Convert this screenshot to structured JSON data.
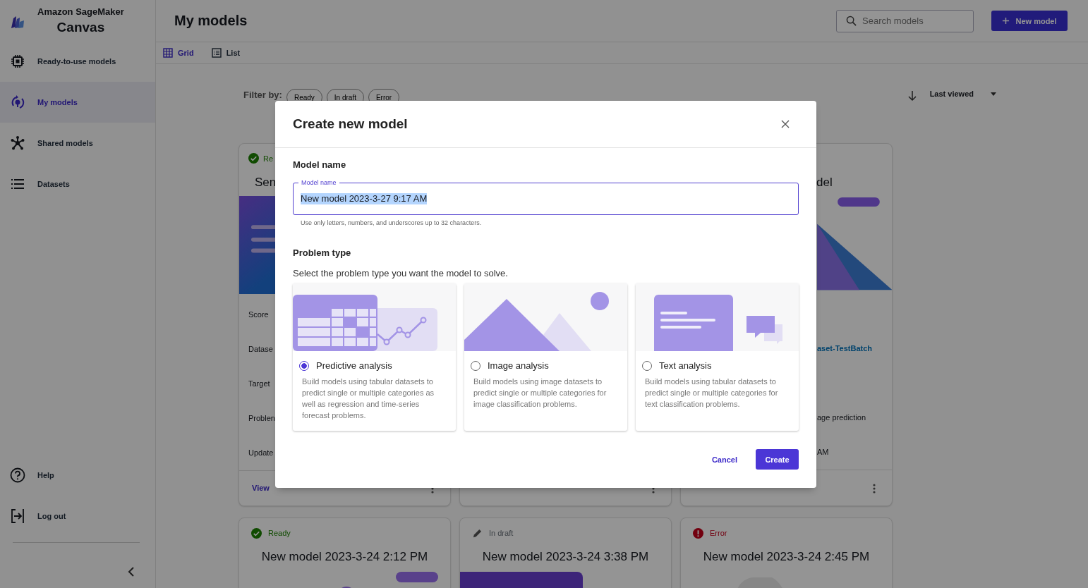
{
  "sidebar": {
    "product": "Amazon SageMaker",
    "app": "Canvas",
    "items": [
      {
        "kind": "chip",
        "label": "Ready-to-use models",
        "selected": false
      },
      {
        "kind": "models",
        "label": "My models",
        "selected": true
      },
      {
        "kind": "shared",
        "label": "Shared models",
        "selected": false
      },
      {
        "kind": "datasets",
        "label": "Datasets",
        "selected": false
      }
    ],
    "bottom_items": [
      {
        "kind": "help",
        "label": "Help"
      },
      {
        "kind": "logout",
        "label": "Log out"
      }
    ]
  },
  "header": {
    "title": "My models",
    "search": {
      "placeholder": "Search models"
    },
    "new_button": "New model"
  },
  "views": [
    {
      "kind": "grid",
      "label": "Grid",
      "selected": true
    },
    {
      "kind": "list",
      "label": "List",
      "selected": false
    }
  ],
  "filter": {
    "label": "Filter by:",
    "chips": [
      "Ready",
      "In draft",
      "Error"
    ]
  },
  "sort": {
    "label": "Last viewed"
  },
  "cards": [
    {
      "kind": "left_part",
      "status": {
        "kind": "ready",
        "label": "Re"
      },
      "title": "Sen",
      "rows": [
        {
          "kind": "label",
          "text": "Score"
        },
        {
          "kind": "label",
          "text": "Datase"
        },
        {
          "kind": "label",
          "text": "Target"
        },
        {
          "kind": "label",
          "text": "Problen"
        },
        {
          "kind": "label",
          "text": "Update"
        }
      ],
      "link": "View"
    },
    {
      "kind": "covered"
    },
    {
      "kind": "right_part",
      "title": "del",
      "rows": [
        {
          "kind": "link",
          "text": "aset-TestBatch"
        },
        {
          "kind": "value",
          "text": "age prediction"
        },
        {
          "kind": "value",
          "text": "AM"
        }
      ]
    },
    {
      "kind": "full",
      "status": {
        "kind": "ready",
        "label": "Ready"
      },
      "title": "New model 2023-3-24 2:12 PM"
    },
    {
      "kind": "full",
      "status": {
        "kind": "draft",
        "label": "In draft"
      },
      "title": "New model 2023-3-24 3:38 PM"
    },
    {
      "kind": "full",
      "status": {
        "kind": "error",
        "label": "Error"
      },
      "title": "New model 2023-3-24 2:45 PM"
    }
  ],
  "dialog": {
    "title": "Create new model",
    "name_heading": "Model name",
    "field": {
      "label": "Model name",
      "value": "New model 2023-3-27 9:17 AM",
      "hint": "Use only letters, numbers, and underscores up to 32 characters."
    },
    "problem_heading": "Problem type",
    "problem_prompt": "Select the problem type you want the model to solve.",
    "options": [
      {
        "kind": "predictive",
        "title": "Predictive analysis",
        "description": "Build models using tabular datasets to predict single or multiple categories as well as regression and time-series forecast problems.",
        "selected": true
      },
      {
        "kind": "image",
        "title": "Image analysis",
        "description": "Build models using image datasets to predict single or multiple categories for image classification problems.",
        "selected": false
      },
      {
        "kind": "text",
        "title": "Text analysis",
        "description": "Build models using tabular datasets to predict single or multiple categories for text classification problems.",
        "selected": false
      }
    ],
    "buttons": [
      {
        "kind": "secondary",
        "label": "Cancel"
      },
      {
        "kind": "primary",
        "label": "Create"
      }
    ]
  }
}
